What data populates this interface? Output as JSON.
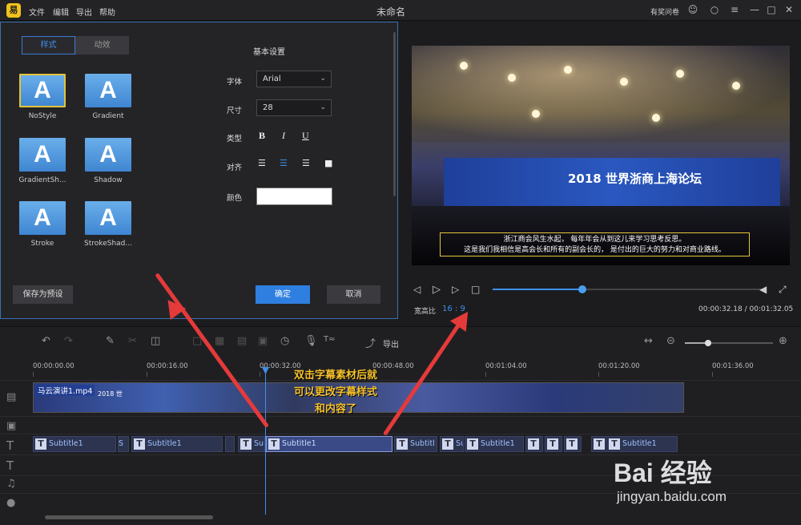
{
  "titlebar": {
    "logo": "易",
    "menu": [
      "文件",
      "编辑",
      "导出",
      "帮助"
    ],
    "title": "未命名",
    "feedback": "有奖问卷"
  },
  "style_panel": {
    "tabs": [
      "样式",
      "动效"
    ],
    "styles": [
      "NoStyle",
      "Gradient",
      "GradientSh...",
      "Shadow",
      "Stroke",
      "StrokeShad..."
    ],
    "tile_letter": "A",
    "section_title": "基本设置",
    "font_label": "字体",
    "font_value": "Arial",
    "size_label": "尺寸",
    "size_value": "28",
    "type_label": "类型",
    "bold": "B",
    "italic": "I",
    "underline": "U",
    "align_label": "对齐",
    "color_label": "颜色",
    "color_value": "#ffffff",
    "save_preset": "保存为预设",
    "ok": "确定",
    "cancel": "取消"
  },
  "preview": {
    "screen_text": "2018 世界浙商上海论坛",
    "subtitle_line1": "浙江商会风生水起，  每年年会从到这儿来学习思考反思。",
    "subtitle_line2": "这是我们我相信是高会长和所有的副会长的，  是付出的巨大的努力和对商业路线。",
    "aspect_label": "宽高比",
    "aspect_value": "16 : 9",
    "time_current": "00:00:32.18",
    "time_sep": "/",
    "time_total": "00:01:32.05",
    "progress": 0.33
  },
  "timeline": {
    "export_label": "导出",
    "ruler": [
      "00:00:00.00",
      "00:00:16.00",
      "00:00:32.00",
      "00:00:48.00",
      "00:01:04.00",
      "00:01:20.00",
      "00:01:36.00"
    ],
    "video_clip": "马云演讲1.mp4",
    "video_clip_thumb": "2018 世",
    "subtitle_clips": [
      {
        "label": "Subtitle1"
      },
      {
        "label": "S"
      },
      {
        "label": "Subtitle1"
      },
      {
        "label": ""
      },
      {
        "label": "Su"
      },
      {
        "label": "Subtitle1"
      },
      {
        "label": "Subtitl"
      },
      {
        "label": "Subtitl"
      },
      {
        "label": "Subtitle1"
      },
      {
        "label": ""
      },
      {
        "label": ""
      },
      {
        "label": ""
      },
      {
        "label": "Subtitle1"
      }
    ]
  },
  "annotation": {
    "line1": "双击字幕素材后就",
    "line2": "可以更改字幕样式",
    "line3": "和内容了"
  },
  "watermark": {
    "text": "Bai 经验",
    "url": "jingyan.baidu.com"
  }
}
